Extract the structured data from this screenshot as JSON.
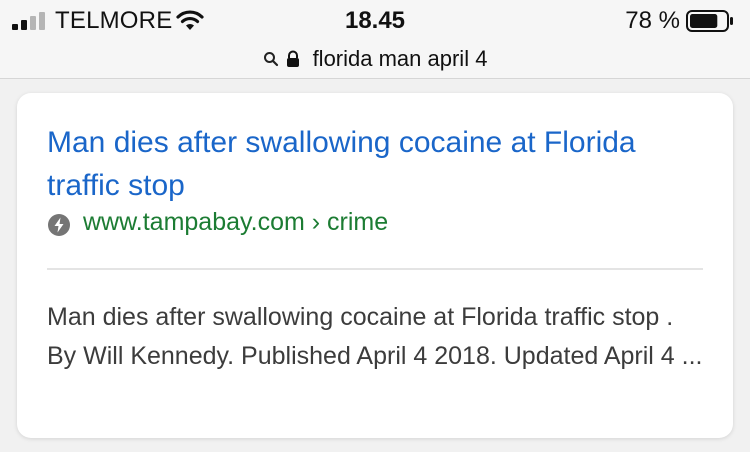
{
  "status_bar": {
    "carrier": "TELMORE",
    "time": "18.45",
    "battery_percent": "78 %",
    "battery_level": 0.78,
    "icons": [
      "signal-icon",
      "wifi-icon",
      "battery-icon"
    ]
  },
  "address_bar": {
    "query": "florida man april 4",
    "icons": [
      "search-icon",
      "lock-icon"
    ]
  },
  "result": {
    "title": "Man dies after swallowing cocaine at Florida traffic stop",
    "url": "www.tampabay.com › crime",
    "snippet": "Man dies after swallowing cocaine at Florida traffic stop . By Will Kennedy. Published April 4 2018. Updated April 4 ...",
    "icon": "amp-lightning-icon"
  },
  "colors": {
    "title_link": "#1a66c9",
    "url_green": "#1c7c33",
    "snippet_text": "#3c3c3c",
    "page_background": "#f1f1f1"
  }
}
